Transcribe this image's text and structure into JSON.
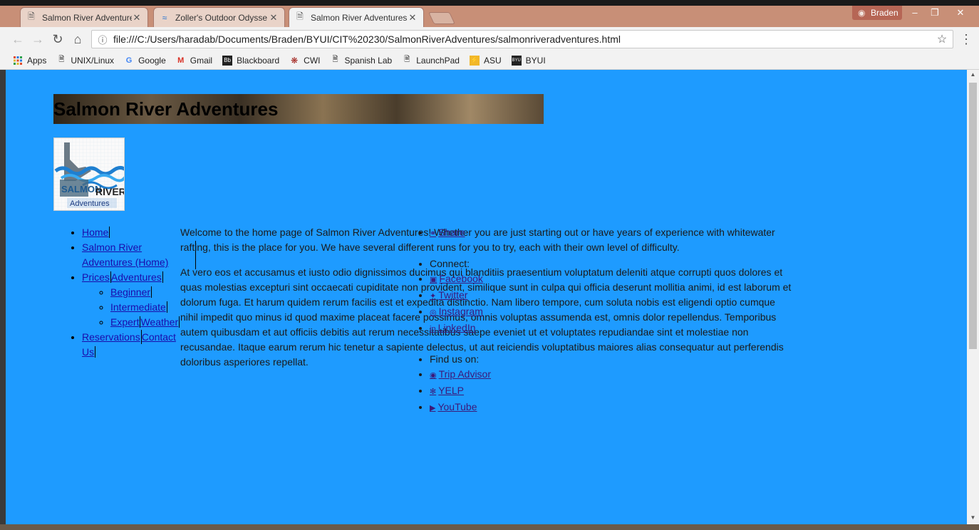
{
  "browser": {
    "tabs": [
      {
        "label": "Salmon River Adventures",
        "icon": "page-icon",
        "active": false
      },
      {
        "label": "Zoller's Outdoor Odysse",
        "icon": "wave-icon",
        "active": false
      },
      {
        "label": "Salmon River Adventures",
        "icon": "page-icon",
        "active": true
      }
    ],
    "profile_name": "Braden",
    "address": "file:///C:/Users/haradab/Documents/Braden/BYUI/CIT%20230/SalmonRiverAdventures/salmonriveradventures.html",
    "bookmarks": [
      {
        "label": "Apps",
        "icon": "apps-grid-icon"
      },
      {
        "label": "UNIX/Linux",
        "icon": "page-icon"
      },
      {
        "label": "Google",
        "icon": "google-icon"
      },
      {
        "label": "Gmail",
        "icon": "gmail-icon"
      },
      {
        "label": "Blackboard",
        "icon": "blackboard-icon"
      },
      {
        "label": "CWI",
        "icon": "cwi-icon"
      },
      {
        "label": "Spanish Lab",
        "icon": "page-icon"
      },
      {
        "label": "LaunchPad",
        "icon": "page-icon"
      },
      {
        "label": "ASU",
        "icon": "asu-icon"
      },
      {
        "label": "BYUI",
        "icon": "byui-icon"
      }
    ]
  },
  "page": {
    "title": "Salmon River Adventures",
    "logo_text_1": "SALMON",
    "logo_text_2": "RIVER",
    "logo_text_3": "Adventures",
    "nav": {
      "home": "Home",
      "salmon_river": "Salmon River Adventures (Home)",
      "prices": "Prices",
      "adventures": "Adventures",
      "beginner": "Beginner",
      "intermediate": "Intermediate",
      "expert": "Expert",
      "weather": "Weather",
      "reservations": "Reservations",
      "contact": "Contact Us"
    },
    "intro": "Welcome to the home page of Salmon River Adventures! Whether you are just starting out or have years of experience with whitewater rafting, this is the place for you. We have several different runs for you to try, each with their own level of difficulty.",
    "lorem": "At vero eos et accusamus et iusto odio dignissimos ducimus qui blanditiis praesentium voluptatum deleniti atque corrupti quos dolores et quas molestias excepturi sint occaecati cupiditate non provident, similique sunt in culpa qui officia deserunt mollitia animi, id est laborum et dolorum fuga. Et harum quidem rerum facilis est et expedita distinctio. Nam libero tempore, cum soluta nobis est eligendi optio cumque nihil impedit quo minus id quod maxime placeat facere possimus, omnis voluptas assumenda est, omnis dolor repellendus. Temporibus autem quibusdam et aut officiis debitis aut rerum necessitatibus saepe eveniet ut et voluptates repudiandae sint et molestiae non recusandae. Itaque earum rerum hic tenetur a sapiente delectus, ut aut reiciendis voluptatibus maiores alias consequatur aut perferendis doloribus asperiores repellat.",
    "side": {
      "share": "Share",
      "connect": "Connect:",
      "facebook": "Facebook",
      "twitter": "Twitter",
      "instagram": "Instagram",
      "linkedin": "LinkedIn",
      "find_us": "Find us on:",
      "tripadvisor": "Trip Advisor",
      "yelp": "YELP",
      "youtube": "YouTube"
    }
  }
}
